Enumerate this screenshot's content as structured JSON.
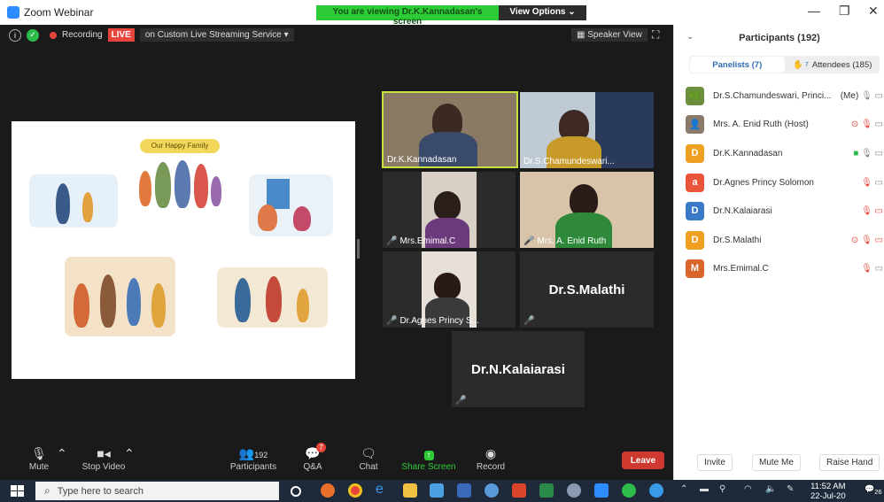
{
  "window": {
    "title": "Zoom Webinar",
    "banner_msg": "You are viewing Dr.K.Kannadasan's screen",
    "view_options": "View Options"
  },
  "topbar": {
    "recording": "Recording",
    "live": "LIVE",
    "stream": "on Custom Live Streaming Service",
    "speaker_view": "Speaker View"
  },
  "share": {
    "caption": "Our Happy Family"
  },
  "tiles": [
    {
      "label": "Dr.K.Kannadasan"
    },
    {
      "label": "Dr.S.Chamundeswari..."
    },
    {
      "label": "Mrs.Emimal.C"
    },
    {
      "label": "Mrs. A. Enid Ruth"
    },
    {
      "label": "Dr.Agnes Princy S..."
    },
    {
      "name": "Dr.S.Malathi"
    },
    {
      "name": "Dr.N.Kalaiarasi"
    }
  ],
  "controls": {
    "mute": "Mute",
    "stop_video": "Stop Video",
    "participants": "Participants",
    "participants_count": "192",
    "qa": "Q&A",
    "qa_badge": "7",
    "chat": "Chat",
    "share_screen": "Share Screen",
    "record": "Record",
    "leave": "Leave"
  },
  "panel": {
    "title": "Participants (192)",
    "panelists_tab": "Panelists (7)",
    "attendees_tab": "Attendees (185)",
    "attendee_badge": "7",
    "participants": [
      {
        "name": "Dr.S.Chamundeswari, Princi...",
        "tag": "(Me)",
        "initial": "",
        "color": "#6b8f3c"
      },
      {
        "name": "Mrs. A. Enid Ruth (Host)",
        "tag": "",
        "initial": "",
        "color": "#8a7a6a"
      },
      {
        "name": "Dr.K.Kannadasan",
        "tag": "",
        "initial": "D",
        "color": "#f0a020"
      },
      {
        "name": "Dr.Agnes Princy Solomon",
        "tag": "",
        "initial": "a",
        "color": "#e8553a"
      },
      {
        "name": "Dr.N.Kalaiarasi",
        "tag": "",
        "initial": "D",
        "color": "#3a78c8"
      },
      {
        "name": "Dr.S.Malathi",
        "tag": "",
        "initial": "D",
        "color": "#f0a020"
      },
      {
        "name": "Mrs.Emimal.C",
        "tag": "",
        "initial": "M",
        "color": "#d9652b"
      }
    ],
    "invite": "Invite",
    "mute_me": "Mute Me",
    "raise_hand": "Raise Hand"
  },
  "taskbar": {
    "search_placeholder": "Type here to search",
    "time": "11:52 AM",
    "date": "22-Jul-20",
    "notif": "26"
  }
}
